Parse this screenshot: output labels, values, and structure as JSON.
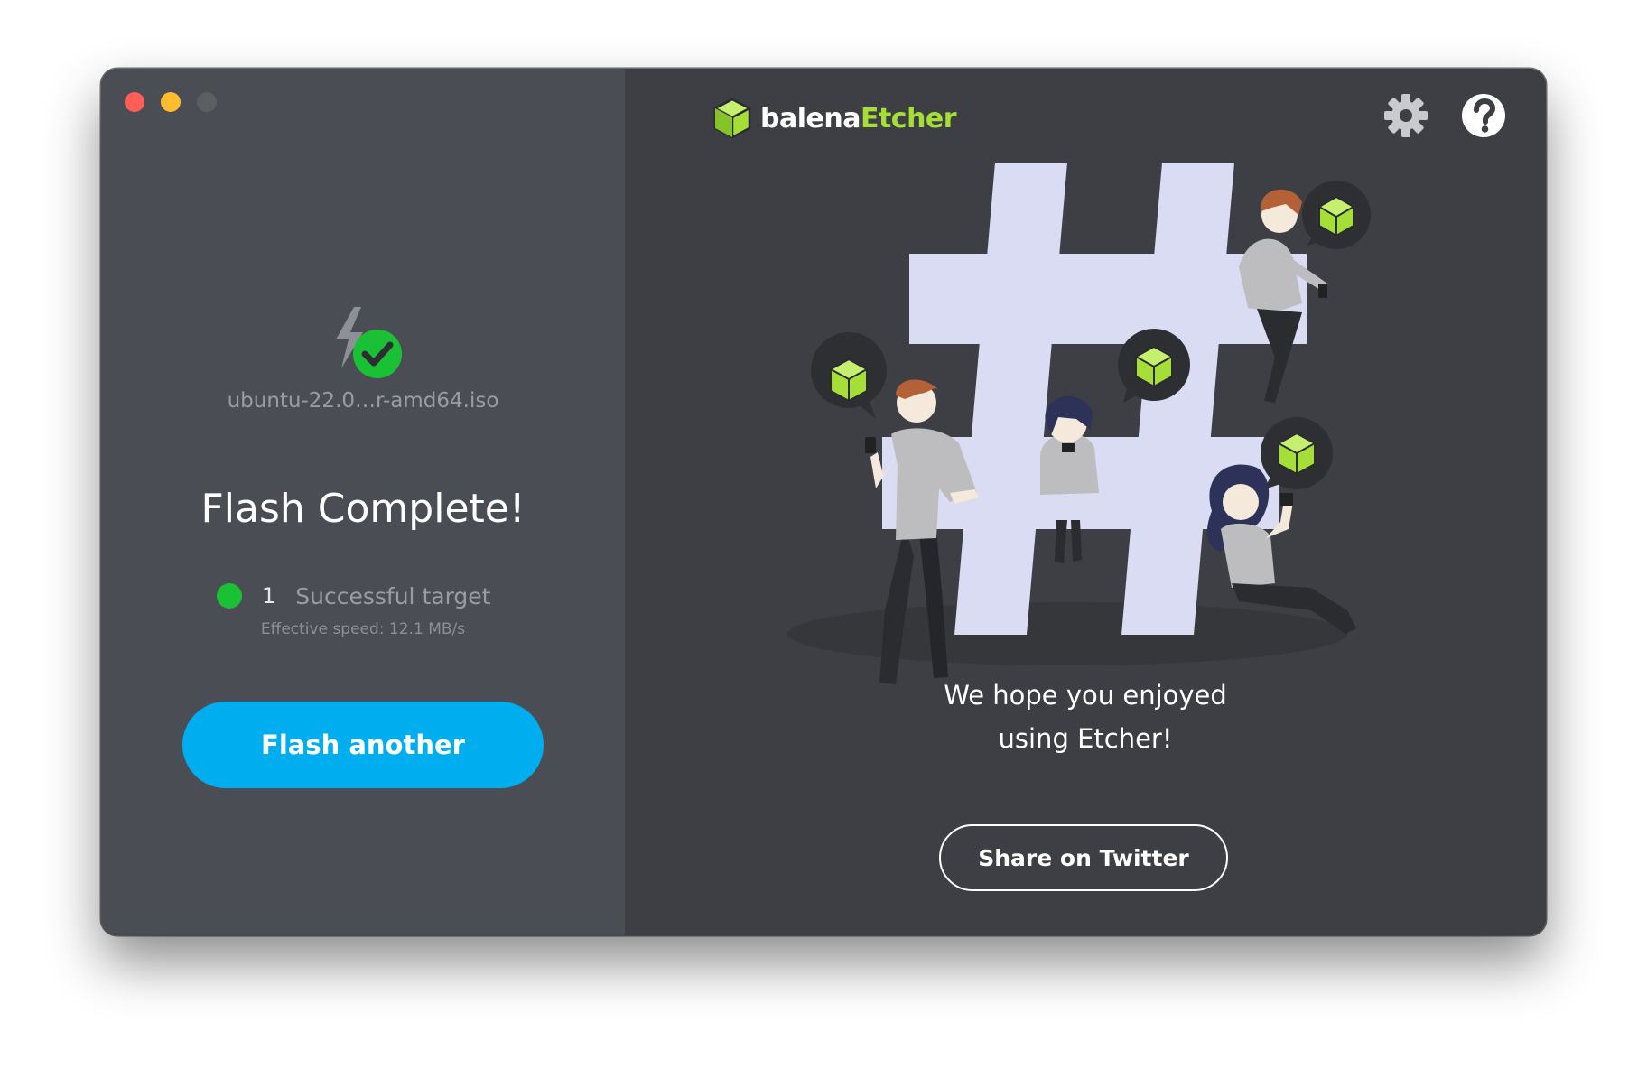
{
  "window": {
    "traffic_lights": [
      {
        "name": "close",
        "color": "#ff5f57"
      },
      {
        "name": "minimize",
        "color": "#febc2e"
      },
      {
        "name": "zoom",
        "color": "#5c5e64"
      }
    ]
  },
  "left_panel": {
    "icon": "flash-complete-icon",
    "filename": "ubuntu-22.0…r-amd64.iso",
    "heading": "Flash Complete!",
    "status": {
      "count": "1",
      "label": "Successful target",
      "dot_color": "#1ac135"
    },
    "speed": "Effective speed: 12.1 MB/s",
    "flash_another_label": "Flash another"
  },
  "header": {
    "logo": {
      "icon": "balena-cube-icon",
      "text_balena": "balena",
      "text_etcher": "Etcher"
    },
    "settings_icon": "gear-icon",
    "help_icon": "question-icon"
  },
  "right_panel": {
    "illustration": "community-hashtag-illustration",
    "message_line1": "We hope you enjoyed",
    "message_line2": "using Etcher!",
    "share_label": "Share on Twitter"
  },
  "colors": {
    "left_bg": "#4b4d54",
    "right_bg": "#3e3f44",
    "accent_blue": "#00aeef",
    "balena_green": "#a5de37",
    "hashtag": "#d9dcf3"
  }
}
